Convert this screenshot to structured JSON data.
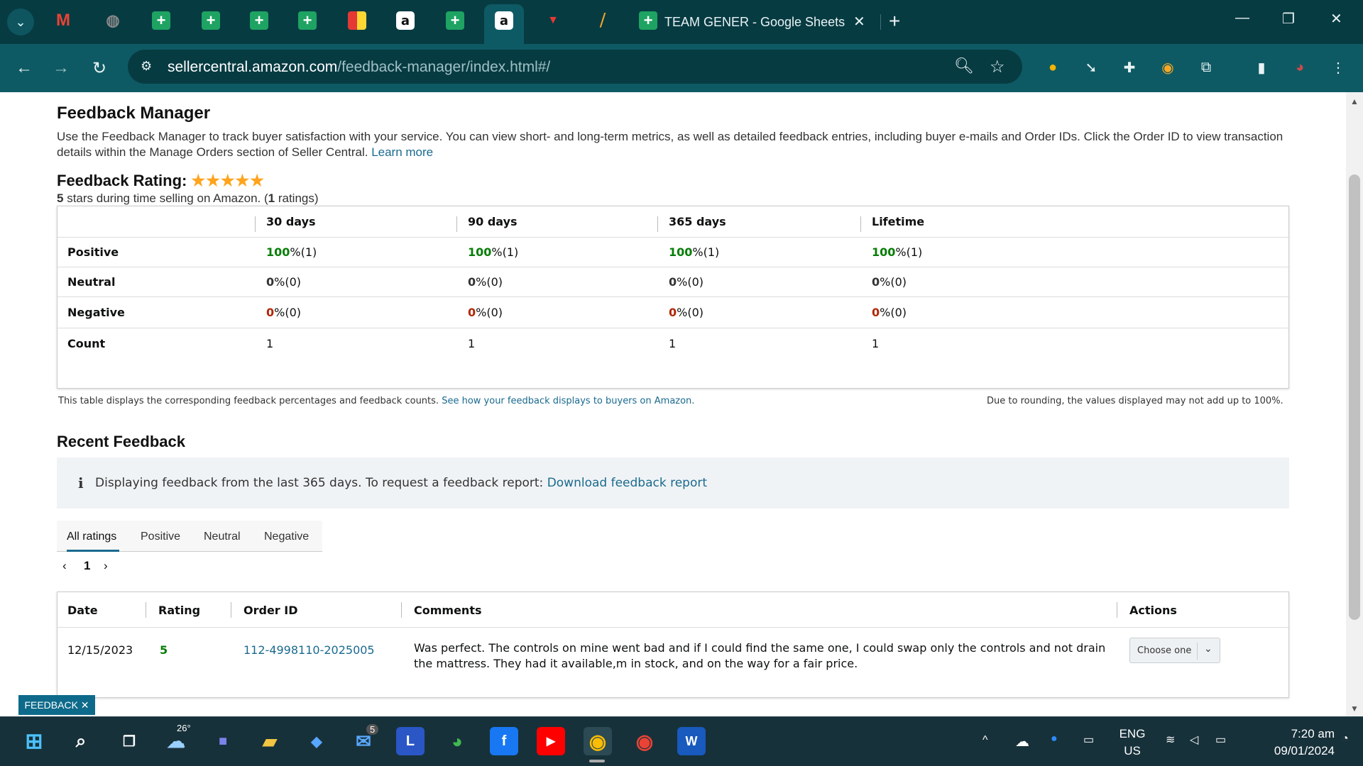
{
  "browser": {
    "menu_icon": "chevron-down",
    "active_tab_title": "TEAM GENER - Google Sheets",
    "url_host": "sellercentral.amazon.com",
    "url_path": "/feedback-manager/index.html#/",
    "new_tab_symbol": "+",
    "tab_close_symbol": "✕",
    "window_controls": [
      "minimize",
      "restore",
      "close"
    ]
  },
  "page": {
    "title": "Feedback Manager",
    "description": "Use the Feedback Manager to track buyer satisfaction with your service. You can view short- and long-term metrics, as well as detailed feedback entries, including buyer e-mails and Order IDs. Click the Order ID to view transaction details within the Manage Orders section of Seller Central.",
    "learn_more": "Learn more",
    "rating_label": "Feedback Rating:",
    "rating_stars": 5,
    "rating_summary_prefix": "5",
    "rating_summary_mid": " stars during time selling on Amazon. (",
    "rating_count": "1",
    "rating_summary_suffix": " ratings)"
  },
  "metrics": {
    "columns": [
      "30 days",
      "90 days",
      "365 days",
      "Lifetime"
    ],
    "rows": [
      {
        "label": "Positive",
        "cells": [
          {
            "num": "100",
            "rest": " %(1)"
          },
          {
            "num": "100",
            "rest": " %(1)"
          },
          {
            "num": "100",
            "rest": " %(1)"
          },
          {
            "num": "100",
            "rest": " %(1)"
          }
        ]
      },
      {
        "label": "Neutral",
        "cells": [
          {
            "num": "0",
            "rest": " %(0)"
          },
          {
            "num": "0",
            "rest": " %(0)"
          },
          {
            "num": "0",
            "rest": " %(0)"
          },
          {
            "num": "0",
            "rest": " %(0)"
          }
        ]
      },
      {
        "label": "Negative",
        "cells": [
          {
            "num": "0",
            "rest": " %(0)"
          },
          {
            "num": "0",
            "rest": " %(0)"
          },
          {
            "num": "0",
            "rest": " %(0)"
          },
          {
            "num": "0",
            "rest": " %(0)"
          }
        ]
      },
      {
        "label": "Count",
        "cells": [
          {
            "num": "",
            "rest": "1"
          },
          {
            "num": "",
            "rest": "1"
          },
          {
            "num": "",
            "rest": "1"
          },
          {
            "num": "",
            "rest": "1"
          }
        ]
      }
    ],
    "note_left": "This table displays the corresponding feedback percentages and feedback counts.",
    "note_link": "See how your feedback displays to buyers on Amazon.",
    "note_right": "Due to rounding, the values displayed may not add up to 100%."
  },
  "recent": {
    "title": "Recent Feedback",
    "info_text": "Displaying feedback from the last 365 days. To request a feedback report:",
    "info_link": "Download feedback report",
    "tabs": [
      "All ratings",
      "Positive",
      "Neutral",
      "Negative"
    ],
    "page_number": "1",
    "table_headers": [
      "Date",
      "Rating",
      "Order ID",
      "Comments",
      "Actions"
    ],
    "rows": [
      {
        "date": "12/15/2023",
        "rating": "5",
        "order_id": "112-4998110-2025005",
        "comment": "Was perfect. The controls on mine went bad and if I could find the same one, I could swap only the controls and not drain the mattress. They had it available,m in stock, and on the way for a fair price.",
        "action": "Choose one"
      }
    ]
  },
  "feedback_button": "FEEDBACK ✕",
  "taskbar": {
    "weather_temp": "26°",
    "mail_badge": "5",
    "lang_line1": "ENG",
    "lang_line2": "US",
    "time": "7:20 am",
    "date": "09/01/2024"
  }
}
